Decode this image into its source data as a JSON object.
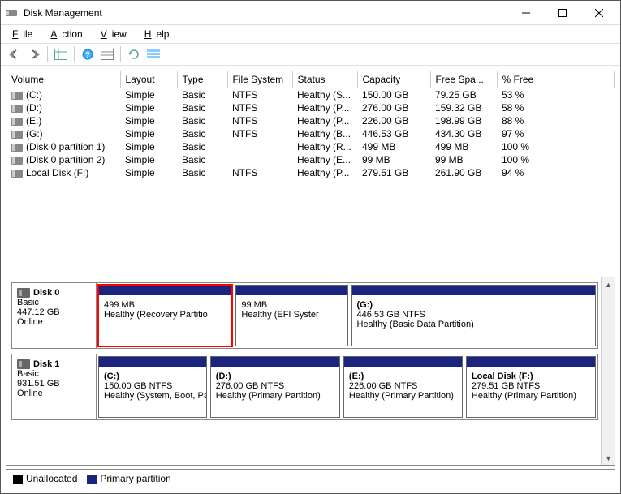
{
  "titlebar": {
    "title": "Disk Management"
  },
  "menubar": {
    "file": "File",
    "action": "Action",
    "view": "View",
    "help": "Help"
  },
  "table": {
    "headers": {
      "volume": "Volume",
      "layout": "Layout",
      "type": "Type",
      "fs": "File System",
      "status": "Status",
      "capacity": "Capacity",
      "free": "Free Spa...",
      "pct": "% Free"
    },
    "rows": [
      {
        "volume": "(C:)",
        "layout": "Simple",
        "type": "Basic",
        "fs": "NTFS",
        "status": "Healthy (S...",
        "capacity": "150.00 GB",
        "free": "79.25 GB",
        "pct": "53 %"
      },
      {
        "volume": "(D:)",
        "layout": "Simple",
        "type": "Basic",
        "fs": "NTFS",
        "status": "Healthy (P...",
        "capacity": "276.00 GB",
        "free": "159.32 GB",
        "pct": "58 %"
      },
      {
        "volume": "(E:)",
        "layout": "Simple",
        "type": "Basic",
        "fs": "NTFS",
        "status": "Healthy (P...",
        "capacity": "226.00 GB",
        "free": "198.99 GB",
        "pct": "88 %"
      },
      {
        "volume": "(G:)",
        "layout": "Simple",
        "type": "Basic",
        "fs": "NTFS",
        "status": "Healthy (B...",
        "capacity": "446.53 GB",
        "free": "434.30 GB",
        "pct": "97 %"
      },
      {
        "volume": "(Disk 0 partition 1)",
        "layout": "Simple",
        "type": "Basic",
        "fs": "",
        "status": "Healthy (R...",
        "capacity": "499 MB",
        "free": "499 MB",
        "pct": "100 %"
      },
      {
        "volume": "(Disk 0 partition 2)",
        "layout": "Simple",
        "type": "Basic",
        "fs": "",
        "status": "Healthy (E...",
        "capacity": "99 MB",
        "free": "99 MB",
        "pct": "100 %"
      },
      {
        "volume": "Local Disk (F:)",
        "layout": "Simple",
        "type": "Basic",
        "fs": "NTFS",
        "status": "Healthy (P...",
        "capacity": "279.51 GB",
        "free": "261.90 GB",
        "pct": "94 %"
      }
    ]
  },
  "disks": [
    {
      "name": "Disk 0",
      "type": "Basic",
      "size": "447.12 GB",
      "status": "Online",
      "partitions": [
        {
          "label": "",
          "size": "499 MB",
          "status": "Healthy (Recovery Partitio",
          "highlight": true,
          "flex": 1.2
        },
        {
          "label": "",
          "size": "99 MB",
          "status": "Healthy (EFI Syster",
          "flex": 1
        },
        {
          "label": "(G:)",
          "size": "446.53 GB NTFS",
          "status": "Healthy (Basic Data Partition)",
          "flex": 2.2
        }
      ]
    },
    {
      "name": "Disk 1",
      "type": "Basic",
      "size": "931.51 GB",
      "status": "Online",
      "partitions": [
        {
          "label": "(C:)",
          "size": "150.00 GB NTFS",
          "status": "Healthy (System, Boot, Pa",
          "flex": 1
        },
        {
          "label": "(D:)",
          "size": "276.00 GB NTFS",
          "status": "Healthy (Primary Partition)",
          "flex": 1.2
        },
        {
          "label": "(E:)",
          "size": "226.00 GB NTFS",
          "status": "Healthy (Primary Partition)",
          "flex": 1.1
        },
        {
          "label": "Local Disk  (F:)",
          "size": "279.51 GB NTFS",
          "status": "Healthy (Primary Partition)",
          "flex": 1.2
        }
      ]
    }
  ],
  "legend": {
    "unallocated": "Unallocated",
    "primary": "Primary partition"
  }
}
